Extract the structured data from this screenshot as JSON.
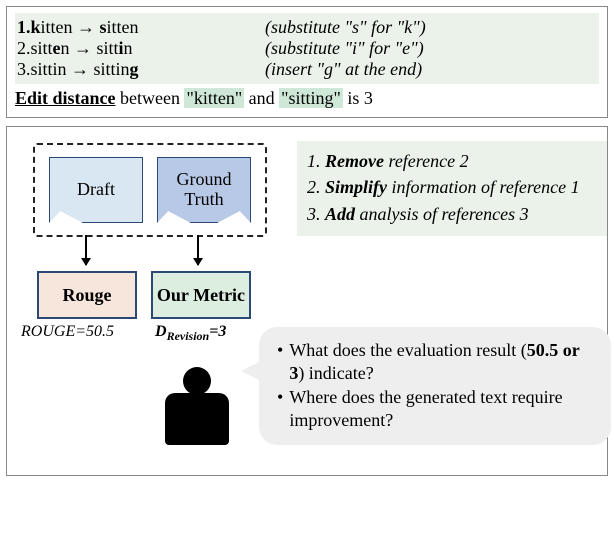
{
  "top": {
    "steps": [
      {
        "num": "1.",
        "from_pre": "",
        "from_bold": "k",
        "from_post": "itten",
        "to_pre": "",
        "to_bold": "s",
        "to_post": "itten",
        "note": "(substitute \"s\" for \"k\")"
      },
      {
        "num": "2.",
        "from_pre": "sitt",
        "from_bold": "e",
        "from_post": "n",
        "to_pre": "sitt",
        "to_bold": "i",
        "to_post": "n",
        "note": "(substitute \"i\" for \"e\")"
      },
      {
        "num": "3.",
        "from_pre": "sittin",
        "from_bold": "",
        "from_post": "",
        "to_pre": "sittin",
        "to_bold": "g",
        "to_post": "",
        "note": "(insert \"g\" at the end)"
      }
    ],
    "summary": {
      "label": "Edit distance",
      "between": " between ",
      "word1": "\"kitten\"",
      "and": " and ",
      "word2": "\"sitting\"",
      "tail": " is 3"
    }
  },
  "bottom": {
    "draft_label": "Draft",
    "gt_label": "Ground Truth",
    "rouge_label": "Rouge",
    "our_label": "Our Metric",
    "rouge_score": "ROUGE=50.5",
    "d_prefix": "D",
    "d_sub": "Revision",
    "d_tail": "=3",
    "ops": [
      {
        "num": "1. ",
        "verb": "Remove",
        "rest": " reference 2"
      },
      {
        "num": "2. ",
        "verb": "Simplify",
        "rest": " information of  reference 1"
      },
      {
        "num": "3. ",
        "verb": "Add",
        "rest": " analysis of references 3"
      }
    ],
    "speech": {
      "q1_pre": "What does the evaluation result (",
      "q1_bold": "50.5 or 3",
      "q1_post": ") indicate?",
      "q2": "Where does the generated text require improvement?"
    }
  }
}
